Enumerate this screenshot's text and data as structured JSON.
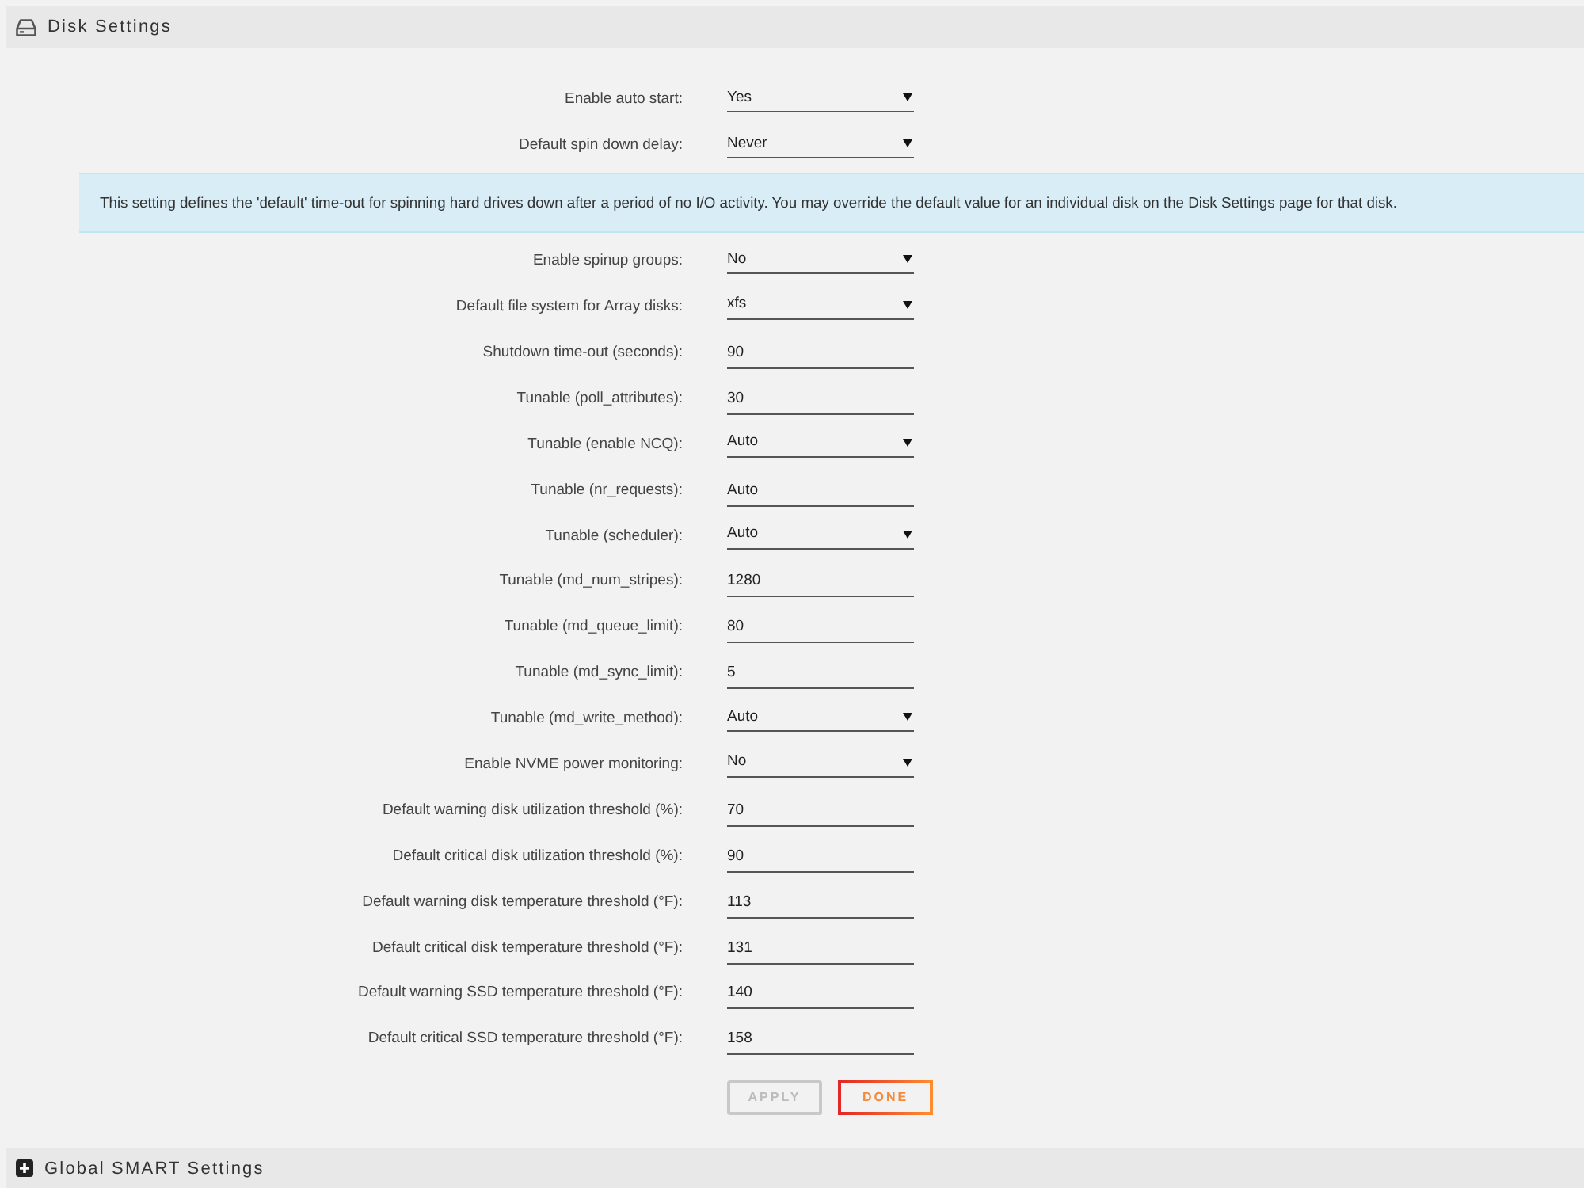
{
  "sections": [
    {
      "title": "Disk Settings",
      "expanded": true,
      "settings": [
        {
          "label": "Enable auto start:",
          "kind": "select",
          "value": "Yes"
        },
        {
          "label": "Default spin down delay:",
          "kind": "select",
          "value": "Never",
          "help": "This setting defines the 'default' time-out for spinning hard drives down after a period of no I/O activity. You may override the default value for an individual disk on the Disk Settings page for that disk."
        },
        {
          "label": "Enable spinup groups:",
          "kind": "select",
          "value": "No"
        },
        {
          "label": "Default file system for Array disks:",
          "kind": "select",
          "value": "xfs"
        },
        {
          "label": "Shutdown time-out (seconds):",
          "kind": "input",
          "value": "90"
        },
        {
          "label": "Tunable (poll_attributes):",
          "kind": "input",
          "value": "30"
        },
        {
          "label": "Tunable (enable NCQ):",
          "kind": "select",
          "value": "Auto"
        },
        {
          "label": "Tunable (nr_requests):",
          "kind": "input",
          "value": "Auto"
        },
        {
          "label": "Tunable (scheduler):",
          "kind": "select",
          "value": "Auto"
        },
        {
          "label": "Tunable (md_num_stripes):",
          "kind": "input",
          "value": "1280"
        },
        {
          "label": "Tunable (md_queue_limit):",
          "kind": "input",
          "value": "80"
        },
        {
          "label": "Tunable (md_sync_limit):",
          "kind": "input",
          "value": "5"
        },
        {
          "label": "Tunable (md_write_method):",
          "kind": "select",
          "value": "Auto"
        },
        {
          "label": "Enable NVME power monitoring:",
          "kind": "select",
          "value": "No"
        },
        {
          "label": "Default warning disk utilization threshold (%):",
          "kind": "input",
          "value": "70"
        },
        {
          "label": "Default critical disk utilization threshold (%):",
          "kind": "input",
          "value": "90"
        },
        {
          "label": "Default warning disk temperature threshold (°F):",
          "kind": "input",
          "value": "113"
        },
        {
          "label": "Default critical disk temperature threshold (°F):",
          "kind": "input",
          "value": "131"
        },
        {
          "label": "Default warning SSD temperature threshold (°F):",
          "kind": "input",
          "value": "140"
        },
        {
          "label": "Default critical SSD temperature threshold (°F):",
          "kind": "input",
          "value": "158"
        }
      ],
      "buttons": [
        {
          "label": "APPLY",
          "disabled": true
        },
        {
          "label": "DONE",
          "disabled": false
        }
      ]
    },
    {
      "title": "Global SMART Settings",
      "expanded": false
    }
  ]
}
